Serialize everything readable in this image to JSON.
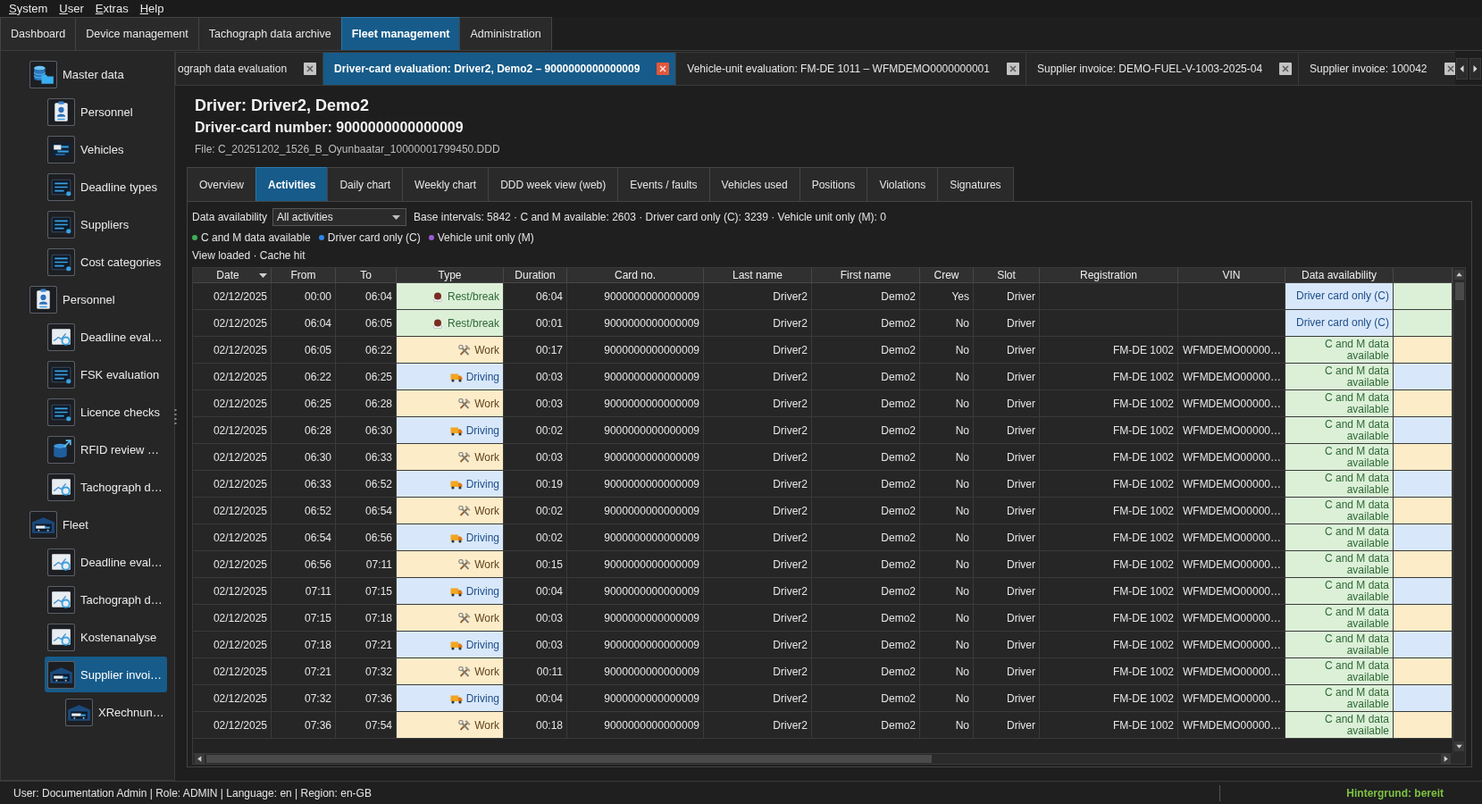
{
  "menu_bar": {
    "items": [
      "System",
      "User",
      "Extras",
      "Help"
    ]
  },
  "module_tabs": [
    {
      "label": "Dashboard",
      "selected": false
    },
    {
      "label": "Device management",
      "selected": false
    },
    {
      "label": "Tachograph data archive",
      "selected": false
    },
    {
      "label": "Fleet management",
      "selected": true
    },
    {
      "label": "Administration",
      "selected": false
    }
  ],
  "sidebar": {
    "items": [
      {
        "label": "Master data",
        "kind": "data",
        "selected": false,
        "children": [
          {
            "label": "Personnel",
            "kind": "people",
            "selected": false
          },
          {
            "label": "Vehicles",
            "kind": "vehicles",
            "selected": false
          },
          {
            "label": "Deadline types",
            "kind": "config",
            "selected": false
          },
          {
            "label": "Suppliers",
            "kind": "config",
            "selected": false
          },
          {
            "label": "Cost categories",
            "kind": "config",
            "selected": false
          }
        ]
      },
      {
        "label": "Personnel",
        "kind": "people",
        "selected": false,
        "children": [
          {
            "label": "Deadline eval…",
            "kind": "report",
            "selected": false
          },
          {
            "label": "FSK evaluation",
            "kind": "config",
            "selected": false
          },
          {
            "label": "Licence checks",
            "kind": "config",
            "selected": false
          },
          {
            "label": "RFID review …",
            "kind": "export",
            "selected": false
          },
          {
            "label": "Tachograph d…",
            "kind": "report",
            "selected": false
          }
        ]
      },
      {
        "label": "Fleet",
        "kind": "fleet",
        "selected": false,
        "children": [
          {
            "label": "Deadline eval…",
            "kind": "report",
            "selected": false
          },
          {
            "label": "Tachograph d…",
            "kind": "report",
            "selected": false
          },
          {
            "label": "Kostenanalyse",
            "kind": "report",
            "selected": false
          },
          {
            "label": "Supplier invoi…",
            "kind": "fleet",
            "selected": true,
            "children": [
              {
                "label": "XRechnun…",
                "kind": "fleet",
                "selected": false
              }
            ]
          }
        ]
      }
    ]
  },
  "document_tabs": [
    {
      "label": "ograph data evaluation",
      "selected": false
    },
    {
      "label": "Driver-card evaluation: Driver2, Demo2 – 9000000000000009",
      "selected": true
    },
    {
      "label": "Vehicle-unit evaluation: FM-DE 1011 – WFMDEMO0000000001",
      "selected": false
    },
    {
      "label": "Supplier invoice: DEMO-FUEL-V-1003-2025-04",
      "selected": false
    },
    {
      "label": "Supplier invoice: 100042",
      "selected": false
    }
  ],
  "header": {
    "title": "Driver: Driver2, Demo2",
    "card_number": "Driver-card number: 9000000000000009",
    "file": "File: C_20251202_1526_B_Oyunbaatar_10000001799450.DDD"
  },
  "view_tabs": [
    {
      "label": "Overview",
      "selected": false
    },
    {
      "label": "Activities",
      "selected": true
    },
    {
      "label": "Daily chart",
      "selected": false
    },
    {
      "label": "Weekly chart",
      "selected": false
    },
    {
      "label": "DDD week view (web)",
      "selected": false
    },
    {
      "label": "Events / faults",
      "selected": false
    },
    {
      "label": "Vehicles used",
      "selected": false
    },
    {
      "label": "Positions",
      "selected": false
    },
    {
      "label": "Violations",
      "selected": false
    },
    {
      "label": "Signatures",
      "selected": false
    }
  ],
  "filter": {
    "label": "Data availability",
    "dropdown": {
      "value": "All activities"
    },
    "summary": "Base intervals: 5842 · C and M available: 2603 · Driver card only (C): 3239 · Vehicle unit only (M): 0"
  },
  "legend": [
    {
      "label": "C and M data available",
      "color": "#3fae5a"
    },
    {
      "label": "Driver card only (C)",
      "color": "#2f86e6"
    },
    {
      "label": "Vehicle unit only (M)",
      "color": "#9a5bd6"
    }
  ],
  "cache_status": "View loaded · Cache hit",
  "table": {
    "columns": [
      {
        "label": "Date",
        "sorted": true
      },
      {
        "label": "From",
        "sorted": false
      },
      {
        "label": "To",
        "sorted": false
      },
      {
        "label": "Type",
        "sorted": false
      },
      {
        "label": "Duration",
        "sorted": false
      },
      {
        "label": "Card no.",
        "sorted": false
      },
      {
        "label": "Last name",
        "sorted": false
      },
      {
        "label": "First name",
        "sorted": false
      },
      {
        "label": "Crew",
        "sorted": false
      },
      {
        "label": "Slot",
        "sorted": false
      },
      {
        "label": "Registration",
        "sorted": false
      },
      {
        "label": "VIN",
        "sorted": false
      },
      {
        "label": "Data availability",
        "sorted": false
      }
    ],
    "rows": [
      {
        "date": "02/12/2025",
        "from": "00:00",
        "to": "06:04",
        "type": {
          "kind": "rest",
          "label": "Rest/break"
        },
        "duration": "06:04",
        "card_no": "9000000000000009",
        "last_name": "Driver2",
        "first_name": "Demo2",
        "crew": "Yes",
        "slot": "Driver",
        "availability": {
          "kind": "card",
          "label": "Driver card only (C)"
        }
      },
      {
        "date": "02/12/2025",
        "from": "06:04",
        "to": "06:05",
        "type": {
          "kind": "rest",
          "label": "Rest/break"
        },
        "duration": "00:01",
        "card_no": "9000000000000009",
        "last_name": "Driver2",
        "first_name": "Demo2",
        "crew": "No",
        "slot": "Driver",
        "availability": {
          "kind": "card",
          "label": "Driver card only (C)"
        }
      },
      {
        "date": "02/12/2025",
        "from": "06:05",
        "to": "06:22",
        "type": {
          "kind": "work",
          "label": "Work"
        },
        "duration": "00:17",
        "card_no": "9000000000000009",
        "last_name": "Driver2",
        "first_name": "Demo2",
        "crew": "No",
        "slot": "Driver",
        "registration": "FM-DE 1002",
        "vin": "WFMDEMO00000…",
        "availability": {
          "kind": "both",
          "label": "C and M data available"
        }
      },
      {
        "date": "02/12/2025",
        "from": "06:22",
        "to": "06:25",
        "type": {
          "kind": "driving",
          "label": "Driving"
        },
        "duration": "00:03",
        "card_no": "9000000000000009",
        "last_name": "Driver2",
        "first_name": "Demo2",
        "crew": "No",
        "slot": "Driver",
        "registration": "FM-DE 1002",
        "vin": "WFMDEMO00000…",
        "availability": {
          "kind": "both",
          "label": "C and M data available"
        }
      },
      {
        "date": "02/12/2025",
        "from": "06:25",
        "to": "06:28",
        "type": {
          "kind": "work",
          "label": "Work"
        },
        "duration": "00:03",
        "card_no": "9000000000000009",
        "last_name": "Driver2",
        "first_name": "Demo2",
        "crew": "No",
        "slot": "Driver",
        "registration": "FM-DE 1002",
        "vin": "WFMDEMO00000…",
        "availability": {
          "kind": "both",
          "label": "C and M data available"
        }
      },
      {
        "date": "02/12/2025",
        "from": "06:28",
        "to": "06:30",
        "type": {
          "kind": "driving",
          "label": "Driving"
        },
        "duration": "00:02",
        "card_no": "9000000000000009",
        "last_name": "Driver2",
        "first_name": "Demo2",
        "crew": "No",
        "slot": "Driver",
        "registration": "FM-DE 1002",
        "vin": "WFMDEMO00000…",
        "availability": {
          "kind": "both",
          "label": "C and M data available"
        }
      },
      {
        "date": "02/12/2025",
        "from": "06:30",
        "to": "06:33",
        "type": {
          "kind": "work",
          "label": "Work"
        },
        "duration": "00:03",
        "card_no": "9000000000000009",
        "last_name": "Driver2",
        "first_name": "Demo2",
        "crew": "No",
        "slot": "Driver",
        "registration": "FM-DE 1002",
        "vin": "WFMDEMO00000…",
        "availability": {
          "kind": "both",
          "label": "C and M data available"
        }
      },
      {
        "date": "02/12/2025",
        "from": "06:33",
        "to": "06:52",
        "type": {
          "kind": "driving",
          "label": "Driving"
        },
        "duration": "00:19",
        "card_no": "9000000000000009",
        "last_name": "Driver2",
        "first_name": "Demo2",
        "crew": "No",
        "slot": "Driver",
        "registration": "FM-DE 1002",
        "vin": "WFMDEMO00000…",
        "availability": {
          "kind": "both",
          "label": "C and M data available"
        }
      },
      {
        "date": "02/12/2025",
        "from": "06:52",
        "to": "06:54",
        "type": {
          "kind": "work",
          "label": "Work"
        },
        "duration": "00:02",
        "card_no": "9000000000000009",
        "last_name": "Driver2",
        "first_name": "Demo2",
        "crew": "No",
        "slot": "Driver",
        "registration": "FM-DE 1002",
        "vin": "WFMDEMO00000…",
        "availability": {
          "kind": "both",
          "label": "C and M data available"
        }
      },
      {
        "date": "02/12/2025",
        "from": "06:54",
        "to": "06:56",
        "type": {
          "kind": "driving",
          "label": "Driving"
        },
        "duration": "00:02",
        "card_no": "9000000000000009",
        "last_name": "Driver2",
        "first_name": "Demo2",
        "crew": "No",
        "slot": "Driver",
        "registration": "FM-DE 1002",
        "vin": "WFMDEMO00000…",
        "availability": {
          "kind": "both",
          "label": "C and M data available"
        }
      },
      {
        "date": "02/12/2025",
        "from": "06:56",
        "to": "07:11",
        "type": {
          "kind": "work",
          "label": "Work"
        },
        "duration": "00:15",
        "card_no": "9000000000000009",
        "last_name": "Driver2",
        "first_name": "Demo2",
        "crew": "No",
        "slot": "Driver",
        "registration": "FM-DE 1002",
        "vin": "WFMDEMO00000…",
        "availability": {
          "kind": "both",
          "label": "C and M data available"
        }
      },
      {
        "date": "02/12/2025",
        "from": "07:11",
        "to": "07:15",
        "type": {
          "kind": "driving",
          "label": "Driving"
        },
        "duration": "00:04",
        "card_no": "9000000000000009",
        "last_name": "Driver2",
        "first_name": "Demo2",
        "crew": "No",
        "slot": "Driver",
        "registration": "FM-DE 1002",
        "vin": "WFMDEMO00000…",
        "availability": {
          "kind": "both",
          "label": "C and M data available"
        }
      },
      {
        "date": "02/12/2025",
        "from": "07:15",
        "to": "07:18",
        "type": {
          "kind": "work",
          "label": "Work"
        },
        "duration": "00:03",
        "card_no": "9000000000000009",
        "last_name": "Driver2",
        "first_name": "Demo2",
        "crew": "No",
        "slot": "Driver",
        "registration": "FM-DE 1002",
        "vin": "WFMDEMO00000…",
        "availability": {
          "kind": "both",
          "label": "C and M data available"
        }
      },
      {
        "date": "02/12/2025",
        "from": "07:18",
        "to": "07:21",
        "type": {
          "kind": "driving",
          "label": "Driving"
        },
        "duration": "00:03",
        "card_no": "9000000000000009",
        "last_name": "Driver2",
        "first_name": "Demo2",
        "crew": "No",
        "slot": "Driver",
        "registration": "FM-DE 1002",
        "vin": "WFMDEMO00000…",
        "availability": {
          "kind": "both",
          "label": "C and M data available"
        }
      },
      {
        "date": "02/12/2025",
        "from": "07:21",
        "to": "07:32",
        "type": {
          "kind": "work",
          "label": "Work"
        },
        "duration": "00:11",
        "card_no": "9000000000000009",
        "last_name": "Driver2",
        "first_name": "Demo2",
        "crew": "No",
        "slot": "Driver",
        "registration": "FM-DE 1002",
        "vin": "WFMDEMO00000…",
        "availability": {
          "kind": "both",
          "label": "C and M data available"
        }
      },
      {
        "date": "02/12/2025",
        "from": "07:32",
        "to": "07:36",
        "type": {
          "kind": "driving",
          "label": "Driving"
        },
        "duration": "00:04",
        "card_no": "9000000000000009",
        "last_name": "Driver2",
        "first_name": "Demo2",
        "crew": "No",
        "slot": "Driver",
        "registration": "FM-DE 1002",
        "vin": "WFMDEMO00000…",
        "availability": {
          "kind": "both",
          "label": "C and M data available"
        }
      },
      {
        "date": "02/12/2025",
        "from": "07:36",
        "to": "07:54",
        "type": {
          "kind": "work",
          "label": "Work"
        },
        "duration": "00:18",
        "card_no": "9000000000000009",
        "last_name": "Driver2",
        "first_name": "Demo2",
        "crew": "No",
        "slot": "Driver",
        "registration": "FM-DE 1002",
        "vin": "WFMDEMO00000…",
        "availability": {
          "kind": "both",
          "label": "C and M data available"
        }
      }
    ]
  },
  "status_bar": {
    "session": "User: Documentation Admin | Role: ADMIN | Language: en | Region: en-GB",
    "background": "Hintergrund: bereit"
  }
}
